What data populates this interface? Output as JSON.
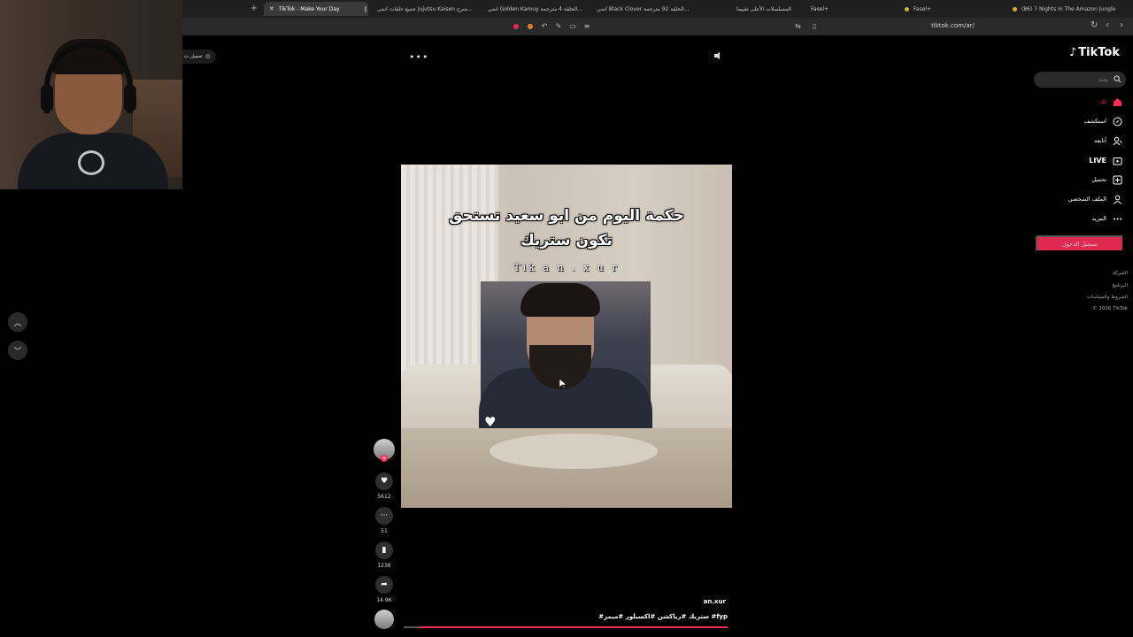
{
  "browser": {
    "tabs": [
      {
        "label": "TikTok - Make Your Day",
        "active": true
      },
      {
        "label": "جميع حلقات انمي Jujutsu Kaisen مترج..."
      },
      {
        "label": "انمي Golden Kamuy الحلقة 4 مترجمة..."
      },
      {
        "label": "انمي Black Clover الحلقة 92 مترجمة..."
      },
      {
        "label": "المسلسلات الأعلى تقييما"
      },
      {
        "label": "Fasel+"
      },
      {
        "label": "Fasel+"
      },
      {
        "label": "(86) 7 Nights In The Amazon Jungle"
      }
    ],
    "new_tab": "+",
    "url": "tiktok.com/ar/"
  },
  "left_pill": {
    "label": "تحميل ت"
  },
  "video": {
    "caption_line1": "حكمة اليوم من ابو سعيد تستحق",
    "caption_line2": "تكون ستريك",
    "watermark": "Tik a n . x u r",
    "author": "an.xur",
    "hashtags": "#ستريك #رياكشن #اكسبلور #ميمز #fyp",
    "progress": 0.95
  },
  "actions": {
    "likes": "5612",
    "comments": "51",
    "saves": "1236",
    "shares": "14.9K"
  },
  "sidebar": {
    "logo": "TikTok",
    "search_placeholder": "بحث",
    "items": [
      {
        "label": "لك",
        "icon": "home-icon",
        "active": true
      },
      {
        "label": "استكشف",
        "icon": "compass-icon"
      },
      {
        "label": "أتابعه",
        "icon": "following-icon"
      },
      {
        "label": "LIVE",
        "icon": "live-icon"
      },
      {
        "label": "تحميل",
        "icon": "upload-icon"
      },
      {
        "label": "الملف الشخصي",
        "icon": "profile-icon"
      },
      {
        "label": "المزيد",
        "icon": "more-icon"
      }
    ],
    "login_button": "تسجيل الدخول",
    "footer": [
      "الشركة",
      "البرنامج",
      "الشروط والسياسات",
      "© 2026 TikTok"
    ]
  },
  "colors": {
    "accent": "#fe2c55",
    "background": "#000000"
  }
}
